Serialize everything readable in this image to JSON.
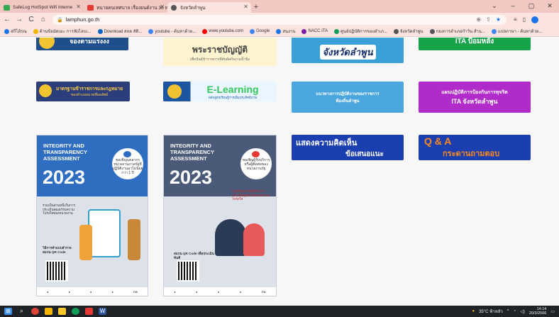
{
  "browser": {
    "tabs": [
      {
        "title": "SafeLog HotSpot Wifi Interne",
        "fav_color": "#34a853",
        "active": false
      },
      {
        "title": "ทนายคนเทศบาล เรื่องยนต์งาน 36 ทาง...",
        "fav_color": "#e53935",
        "active": false
      },
      {
        "title": "จังหวัดลำพูน",
        "fav_color": "#555555",
        "active": true
      }
    ],
    "new_tab": "+",
    "window_controls": [
      "⌄",
      "–",
      "▢",
      "✕"
    ],
    "nav": {
      "back": "←",
      "forward": "→",
      "reload": "C",
      "home": "⌂"
    },
    "url": "lamphun.go.th",
    "bookmarks": [
      {
        "label": "สกีไล้รณ",
        "color": "#1a73e8"
      },
      {
        "label": "ด้านข้อมัตเมะ การฟังไลบเ...",
        "color": "#f4b400"
      },
      {
        "label": "Download สถด สัติ...",
        "color": "#0a66c2"
      },
      {
        "label": "youtube - ค้นหาด้วย...",
        "color": "#4285f4"
      },
      {
        "label": "www.youtube.com",
        "color": "#ff0000"
      },
      {
        "label": "Google",
        "color": "#4285f4"
      },
      {
        "label": "สนงาน",
        "color": "#1a73e8"
      },
      {
        "label": "NACC ITA",
        "color": "#7b1fa2"
      },
      {
        "label": "ศูนย์ปฏิบัติการของอำเภ...",
        "color": "#0f9d58"
      },
      {
        "label": "จังหวัดลำพูน",
        "color": "#555555"
      },
      {
        "label": "กองการอำเภอกำวัน สำน...",
        "color": "#555555"
      },
      {
        "label": "แปลภาษา - ค้นหาด้วย...",
        "color": "#4285f4"
      }
    ]
  },
  "banners": {
    "row1": [
      {
        "text": "จองตามแรงงง",
        "bg": "#1f4e8c",
        "fg": "#ffffff"
      },
      {
        "text": "พระราชบัญญัติ",
        "sub": "เพื่อปันธุ์ข้าราชการที่สัมผัสกับงานน้ำนิ่ง",
        "bg": "#fff4cf",
        "fg": "#444444"
      },
      {
        "text": "จังหวัดลำพูน",
        "bg": "#3aa0d8",
        "fg": "#1a2f6a"
      },
      {
        "text": "ITA ป้อมหลัง",
        "bg": "#16a34a",
        "fg": "#ffffff"
      }
    ],
    "row2": [
      {
        "text": "มาตรฐานข้าราชการและกฎหมาย",
        "sub": "ของตำบลหมวดที่ผลลัพธ์",
        "bg": "#2c3e7a",
        "fg": "#f7c948"
      },
      {
        "text": "E-Learning",
        "sub": "หลักสูตรเรียนรู้การเพิ่มประสิทธิภาพ",
        "bg": "#1d56a0",
        "fg": "#34c759"
      },
      {
        "text": "แนวทางการปฏิบัติงานของราชการ",
        "sub": "ท้องถิ่นลำพูน",
        "bg": "#4aa6dd",
        "fg": "#ffffff"
      },
      {
        "text": "แผนปฏิบัติการป้องกันการทุจริต",
        "sub": "ITA จังหวัดลำพูน",
        "bg": "#b02bc9",
        "fg": "#ffffff"
      }
    ],
    "row3": [
      {
        "text": "แสดงความคิดเห็น",
        "sub": "ข้อเสนอแนะ",
        "bg": "#1c3fb0",
        "fg": "#ffffff"
      },
      {
        "text": "Q & A",
        "sub": "กระดานถามตอบ",
        "bg": "#1c3fb0",
        "fg": "#ff8a1c"
      }
    ]
  },
  "posters": [
    {
      "title": "INTEGRITY AND TRANSPARENCY ASSESSMENT",
      "year": "2023",
      "circle_text": "ขอเชิญบุคลากรหน่วยงานภาครัฐที่ปฏิบัติงานมาไม่น้อยกว่า 1 ปี",
      "note": "ร่วมเป็นส่วนหนึ่งในการประเมินคุณธรรมความโปร่งใสของหน่วยงาน",
      "qr_label": "วิธีการทำแบบสำรวจ สแกน QR Code",
      "accent": "#2e6dbf",
      "circle_icon": "#2e6dbf"
    },
    {
      "title": "INTEGRITY AND TRANSPARENCY ASSESSMENT",
      "year": "2023",
      "circle_text": "ขอเชิญผู้รับบริการหรือผู้ติดต่อของหน่วยงานรัฐ",
      "note": "ร่วมเป็นส่วนหนึ่งในการประเมินคุณธรรมและความโปร่งใส",
      "qr_label": "สแกน QR Code เพื่อประเมินทันที",
      "accent": "#4a5a78",
      "circle_icon": "#e53935"
    }
  ],
  "taskbar": {
    "icons": [
      "windows-logo",
      "search",
      "chrome",
      "vscode",
      "file-explorer",
      "edge",
      "terminal",
      "word"
    ],
    "weather": "35°C ฟ้าหลัว",
    "time": "14:14",
    "date": "20/3/2566"
  }
}
